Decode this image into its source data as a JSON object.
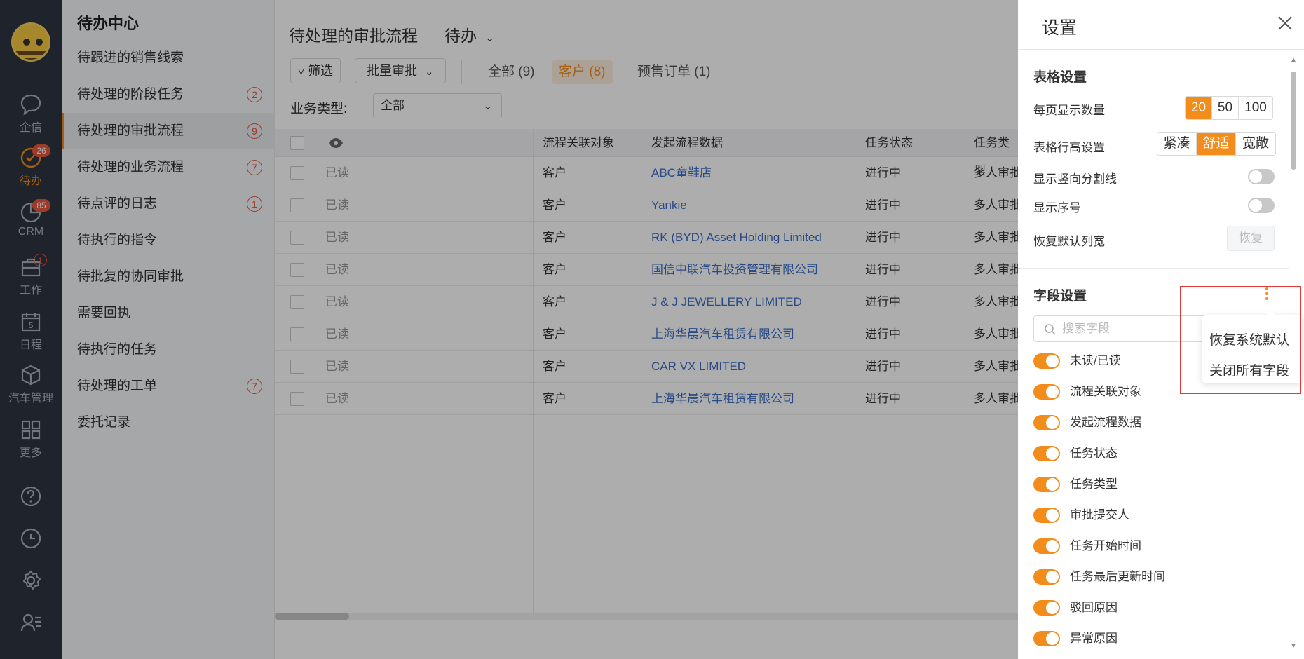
{
  "rail": {
    "items": [
      {
        "label": "企信",
        "icon": "chat-bubble-icon",
        "badge": ""
      },
      {
        "label": "待办",
        "icon": "check-circle-icon",
        "badge": "26"
      },
      {
        "label": "CRM",
        "icon": "pie-chart-icon",
        "badge": "85"
      },
      {
        "label": "工作",
        "icon": "briefcase-icon",
        "badge": "1"
      },
      {
        "label": "日程",
        "icon": "calendar-icon",
        "badge": "",
        "calendar_day": "5"
      },
      {
        "label": "汽车管理",
        "icon": "cube-icon",
        "badge": ""
      },
      {
        "label": "更多",
        "icon": "grid-icon",
        "badge": ""
      }
    ],
    "bottom_icons": [
      "help-icon",
      "clock-icon",
      "settings-icon",
      "user-list-icon"
    ]
  },
  "nav": {
    "title": "待办中心",
    "items": [
      {
        "label": "待跟进的销售线索",
        "count": ""
      },
      {
        "label": "待处理的阶段任务",
        "count": "2"
      },
      {
        "label": "待处理的审批流程",
        "count": "9"
      },
      {
        "label": "待处理的业务流程",
        "count": "7"
      },
      {
        "label": "待点评的日志",
        "count": "1"
      },
      {
        "label": "待执行的指令",
        "count": ""
      },
      {
        "label": "待批复的协同审批",
        "count": ""
      },
      {
        "label": "需要回执",
        "count": ""
      },
      {
        "label": "待执行的任务",
        "count": ""
      },
      {
        "label": "待处理的工单",
        "count": "7"
      },
      {
        "label": "委托记录",
        "count": ""
      }
    ]
  },
  "main": {
    "title": "待处理的审批流程",
    "status_dropdown": "待办",
    "filter_label": "筛选",
    "batch_label": "批量审批",
    "tabs": [
      {
        "label": "全部 (9)"
      },
      {
        "label": "客户 (8)"
      },
      {
        "label": "预售订单 (1)"
      }
    ],
    "biz_type_label": "业务类型:",
    "biz_type_value": "全部",
    "columns": [
      "流程关联对象",
      "发起流程数据",
      "任务状态",
      "任务类型"
    ],
    "rows": [
      {
        "read": "已读",
        "object": "客户",
        "data": "ABC童鞋店",
        "status": "进行中",
        "type": "多人审批"
      },
      {
        "read": "已读",
        "object": "客户",
        "data": "Yankie",
        "status": "进行中",
        "type": "多人审批"
      },
      {
        "read": "已读",
        "object": "客户",
        "data": "RK (BYD) Asset Holding Limited",
        "status": "进行中",
        "type": "多人审批"
      },
      {
        "read": "已读",
        "object": "客户",
        "data": "国信中联汽车投资管理有限公司",
        "status": "进行中",
        "type": "多人审批"
      },
      {
        "read": "已读",
        "object": "客户",
        "data": "J & J JEWELLERY LIMITED",
        "status": "进行中",
        "type": "多人审批"
      },
      {
        "read": "已读",
        "object": "客户",
        "data": "上海华晨汽车租赁有限公司",
        "status": "进行中",
        "type": "多人审批"
      },
      {
        "read": "已读",
        "object": "客户",
        "data": "CAR VX LIMITED",
        "status": "进行中",
        "type": "多人审批"
      },
      {
        "read": "已读",
        "object": "客户",
        "data": "上海华晨汽车租赁有限公司",
        "status": "进行中",
        "type": "多人审批"
      }
    ]
  },
  "drawer": {
    "title": "设置",
    "table_settings_title": "表格设置",
    "page_size_label": "每页显示数量",
    "page_size_options": [
      "20",
      "50",
      "100"
    ],
    "page_size_selected": "20",
    "row_height_label": "表格行高设置",
    "row_height_options": [
      "紧凑",
      "舒适",
      "宽敞"
    ],
    "row_height_selected": "舒适",
    "vline_label": "显示竖向分割线",
    "vline_on": false,
    "seq_label": "显示序号",
    "seq_on": false,
    "restore_width_label": "恢复默认列宽",
    "restore_btn": "恢复",
    "field_settings_title": "字段设置",
    "search_placeholder": "搜索字段",
    "menu_items": [
      "恢复系统默认",
      "关闭所有字段"
    ],
    "fields": [
      {
        "label": "未读/已读",
        "on": true
      },
      {
        "label": "流程关联对象",
        "on": true
      },
      {
        "label": "发起流程数据",
        "on": true
      },
      {
        "label": "任务状态",
        "on": true
      },
      {
        "label": "任务类型",
        "on": true
      },
      {
        "label": "审批提交人",
        "on": true
      },
      {
        "label": "任务开始时间",
        "on": true
      },
      {
        "label": "任务最后更新时间",
        "on": true
      },
      {
        "label": "驳回原因",
        "on": true
      },
      {
        "label": "异常原因",
        "on": true
      }
    ]
  },
  "colors": {
    "accent": "#f28c1b",
    "link": "#3b6fc7",
    "badge": "#e8563f",
    "rail_bg": "#2f3641",
    "highlight_box": "#e53935"
  }
}
